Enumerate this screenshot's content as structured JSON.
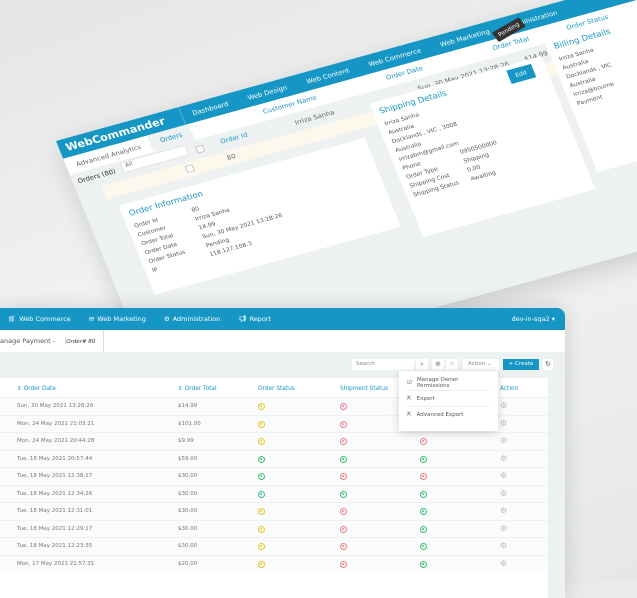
{
  "colors": {
    "brand": "#1696c4",
    "pending": "#e6c81e",
    "failed": "#f07b85",
    "success": "#3cbf74"
  },
  "top": {
    "logo": "WebCommander",
    "nav": [
      "Dashboard",
      "Web Design",
      "Web Content",
      "Web Commerce",
      "Web Marketing",
      "Administration"
    ],
    "tabs": [
      "Advanced Analytics",
      "Orders"
    ],
    "orders_count": "Orders (80)",
    "filter": "All",
    "headers": [
      "Order Id",
      "Customer Name",
      "Order Date",
      "Order Total",
      "Order Status"
    ],
    "row": {
      "id": "80",
      "customer": "Irriza Sanha",
      "date": "Sun, 30 May 2021 13:28:26",
      "total": "$14.99"
    },
    "tooltip": "Pending",
    "edit": "Edit",
    "order_info": {
      "title": "Order Information",
      "fields": [
        [
          "Order Id",
          "80"
        ],
        [
          "Customer",
          "Irriza Sanha"
        ],
        [
          "Order Total",
          "14.99"
        ],
        [
          "Order Date",
          "Sun, 30 May 2021 13:28:26"
        ],
        [
          "Order Status",
          "Pending"
        ],
        [
          "IP",
          "118.127.108.3"
        ]
      ]
    },
    "shipping": {
      "title": "Shipping Details",
      "lines": [
        "Irriza Sanha",
        "Australia",
        "Docklands , VIC , 3008",
        "Australia",
        "irrizabm@gmail.com"
      ],
      "fields": [
        [
          "Phone",
          "0950500000"
        ],
        [
          "Order Type",
          "Shipping"
        ],
        [
          "Shipping Cost",
          "0.00"
        ],
        [
          "Shipping Status",
          "Awaiting"
        ]
      ]
    },
    "billing": {
      "title": "Billing Details",
      "lines": [
        "Irriza Sanha",
        "Australia",
        "Docklands , VIC",
        "Australia",
        "irriza@bourne"
      ],
      "payment": "Payment"
    }
  },
  "bottom": {
    "nav": [
      {
        "icon": "cart-icon",
        "label": "Web Commerce"
      },
      {
        "icon": "mail-icon",
        "label": "Web Marketing"
      },
      {
        "icon": "gear-icon",
        "label": "Administration"
      },
      {
        "icon": "megaphone-icon",
        "label": "Report"
      }
    ],
    "user": "dev-in-sqa2",
    "breadcrumb": "anage Payment - ",
    "breadcrumb_order": "Order# 80",
    "search_placeholder": "Search",
    "action": "Action",
    "create": "+ Create",
    "headers": [
      "Order Date",
      "Order Total",
      "Order Status",
      "Shipment Status",
      "Action"
    ],
    "menu": [
      "Manage Owner Permissions",
      "Export",
      "Advanced Export"
    ],
    "rows": [
      {
        "date": "Sun, 30 May 2021 13:28:26",
        "total": "$14.99",
        "status": [
          "pending",
          "failed",
          null
        ]
      },
      {
        "date": "Mon, 24 May 2021 21:03:21",
        "total": "$101.00",
        "status": [
          "pending",
          "failed",
          null
        ]
      },
      {
        "date": "Mon, 24 May 2021 20:44:28",
        "total": "$9.99",
        "status": [
          "pending",
          "failed",
          "failed"
        ]
      },
      {
        "date": "Tue, 18 May 2021 20:57:44",
        "total": "$59.00",
        "status": [
          "success",
          "success",
          "success"
        ]
      },
      {
        "date": "Tue, 18 May 2021 12:38:17",
        "total": "$30.00",
        "status": [
          "success",
          "failed",
          "failed"
        ]
      },
      {
        "date": "Tue, 18 May 2021 12:34:26",
        "total": "$30.00",
        "status": [
          "success",
          "success",
          "success"
        ]
      },
      {
        "date": "Tue, 18 May 2021 12:31:01",
        "total": "$30.00",
        "status": [
          "pending",
          "failed",
          "success"
        ]
      },
      {
        "date": "Tue, 18 May 2021 12:29:17",
        "total": "$30.00",
        "status": [
          "pending",
          "failed",
          "success"
        ]
      },
      {
        "date": "Tue, 18 May 2021 12:23:35",
        "total": "$30.00",
        "status": [
          "pending",
          "failed",
          "success"
        ]
      },
      {
        "date": "Mon, 17 May 2021 21:57:31",
        "total": "$20.00",
        "status": [
          "pending",
          "failed",
          "success"
        ]
      }
    ]
  }
}
